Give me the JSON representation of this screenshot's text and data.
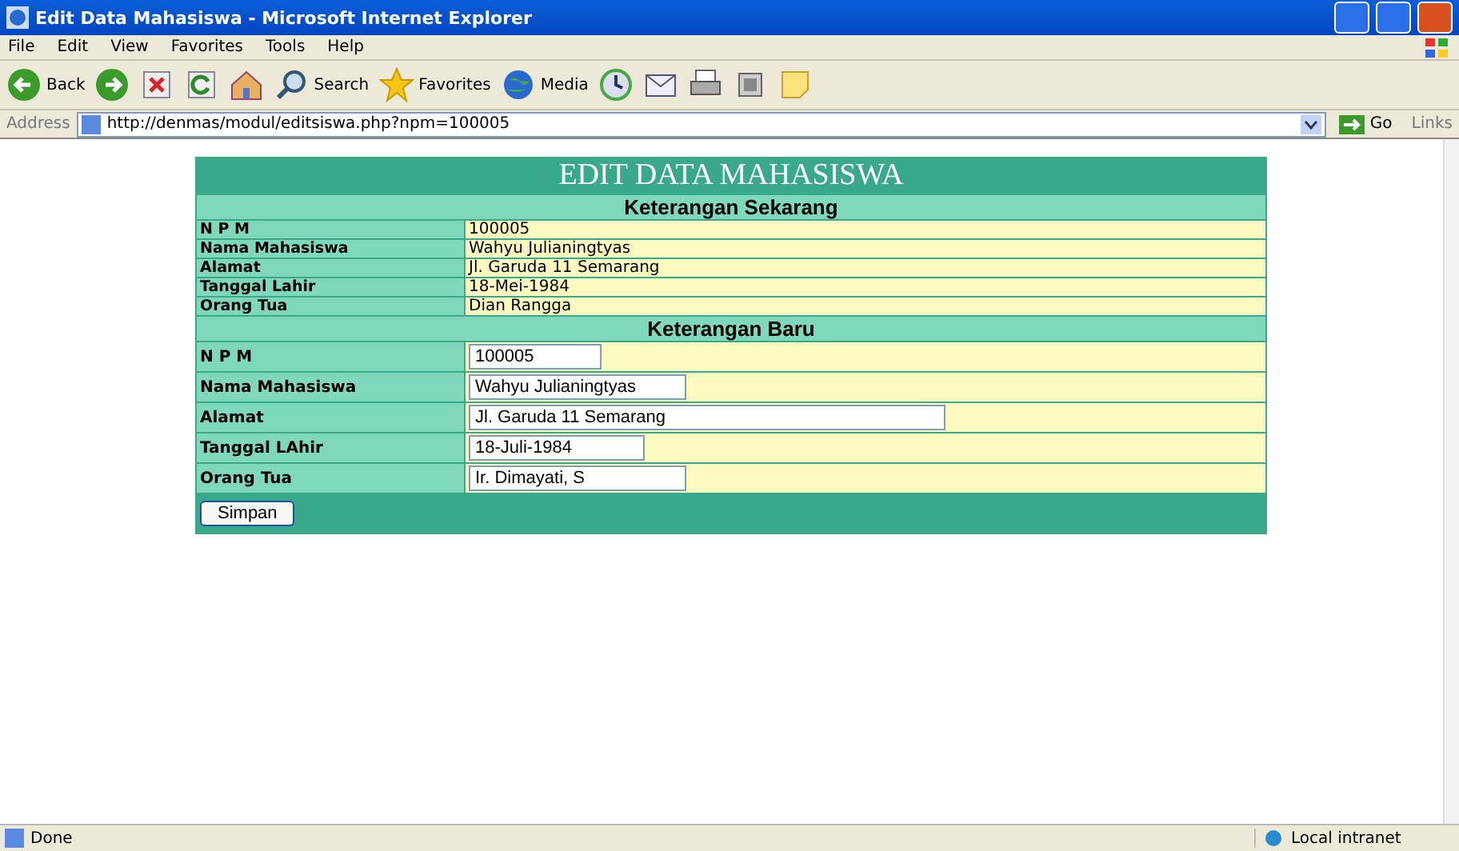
{
  "window": {
    "title": "Edit Data Mahasiswa - Microsoft Internet Explorer"
  },
  "menu": [
    "File",
    "Edit",
    "View",
    "Favorites",
    "Tools",
    "Help"
  ],
  "toolbar": [
    {
      "kind": "back",
      "label": "Back"
    },
    {
      "kind": "forward"
    },
    {
      "kind": "stop"
    },
    {
      "kind": "refresh"
    },
    {
      "kind": "home"
    },
    {
      "kind": "search",
      "label": "Search"
    },
    {
      "kind": "favorites",
      "label": "Favorites"
    },
    {
      "kind": "media",
      "label": "Media"
    },
    {
      "kind": "history"
    },
    {
      "kind": "mail"
    },
    {
      "kind": "print"
    },
    {
      "kind": "edit"
    },
    {
      "kind": "note"
    }
  ],
  "address": {
    "label": "Address",
    "url": "http://denmas/modul/editsiswa.php?npm=100005",
    "go": "Go",
    "links": "Links"
  },
  "form": {
    "title": "EDIT DATA MAHASISWA",
    "current_header": "Keterangan Sekarang",
    "current": [
      {
        "label": "N P M",
        "value": "100005"
      },
      {
        "label": "Nama Mahasiswa",
        "value": "Wahyu Julianingtyas"
      },
      {
        "label": "Alamat",
        "value": "Jl. Garuda 11 Semarang"
      },
      {
        "label": "Tanggal Lahir",
        "value": "18-Mei-1984"
      },
      {
        "label": "Orang Tua",
        "value": "Dian Rangga"
      }
    ],
    "new_header": "Keterangan Baru",
    "new": [
      {
        "label": "N P M",
        "value": "100005"
      },
      {
        "label": "Nama Mahasiswa",
        "value": "Wahyu Julianingtyas"
      },
      {
        "label": "Alamat",
        "value": "Jl. Garuda 11 Semarang"
      },
      {
        "label": "Tanggal LAhir",
        "value": "18-Juli-1984"
      },
      {
        "label": "Orang Tua",
        "value": "Ir. Dimayati, S"
      }
    ],
    "submit": "Simpan"
  },
  "status_bar": {
    "text": "Done",
    "zone": "Local intranet"
  }
}
